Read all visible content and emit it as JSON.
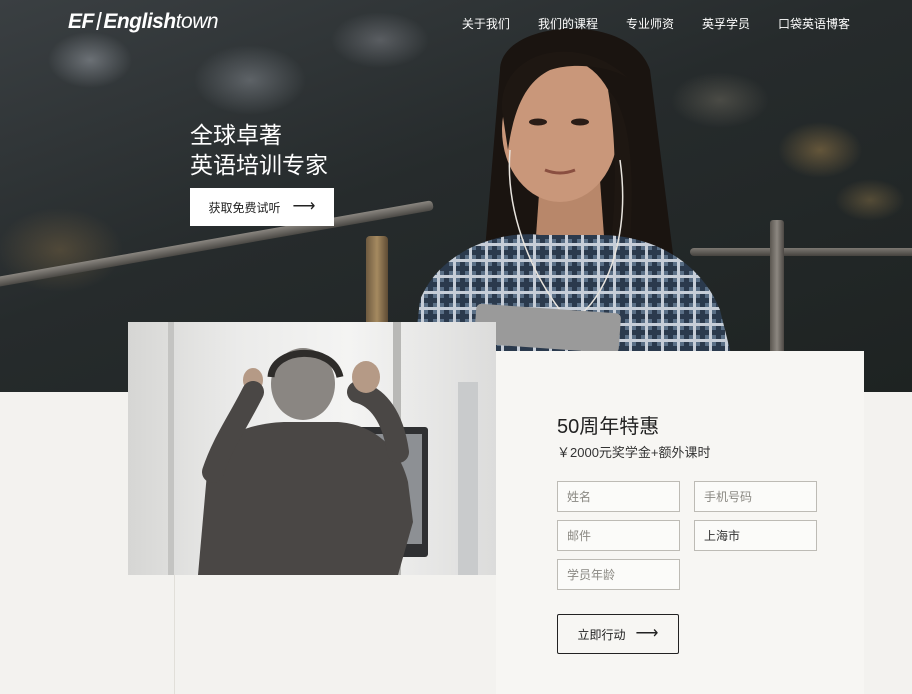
{
  "header": {
    "logo_ef": "EF",
    "logo_english": "English",
    "logo_town": "town",
    "nav": [
      {
        "label": "关于我们"
      },
      {
        "label": "我们的课程"
      },
      {
        "label": "专业师资"
      },
      {
        "label": "英孚学员"
      },
      {
        "label": "口袋英语博客"
      }
    ]
  },
  "hero": {
    "title_line1": "全球卓著",
    "title_line2": "英语培训专家",
    "cta_label": "获取免费试听",
    "cta_icon": "arrow-right-icon"
  },
  "offer": {
    "title": "50周年特惠",
    "subtitle": "￥2000元奖学金+额外课时"
  },
  "form": {
    "name_placeholder": "姓名",
    "phone_placeholder": "手机号码",
    "email_placeholder": "邮件",
    "city_value": "上海市",
    "age_placeholder": "学员年龄",
    "submit_label": "立即行动",
    "submit_icon": "arrow-right-icon"
  }
}
